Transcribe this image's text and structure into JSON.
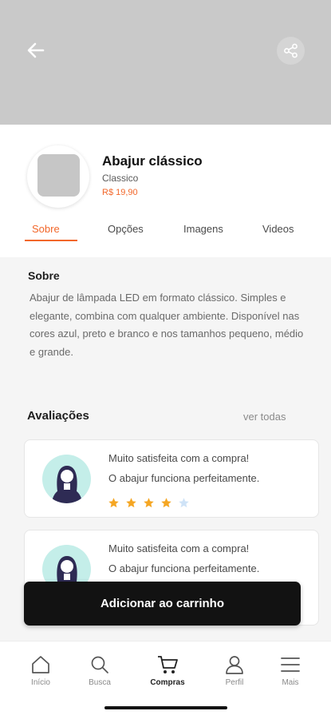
{
  "header": {
    "back_icon": "arrow-left-icon",
    "share_icon": "share-icon"
  },
  "product": {
    "title": "Abajur clássico",
    "subtitle": "Classico",
    "price": "R$ 19,90"
  },
  "tabs": [
    {
      "label": "Sobre",
      "active": true
    },
    {
      "label": "Opções",
      "active": false
    },
    {
      "label": "Imagens",
      "active": false
    },
    {
      "label": "Videos",
      "active": false
    }
  ],
  "about": {
    "title": "Sobre",
    "description": "Abajur de lâmpada LED em formato clássico. Simples e elegante, combina com qualquer ambiente. Disponível nas cores azul, preto e branco e nos tamanhos pequeno, médio e grande."
  },
  "reviews": {
    "title": "Avaliações",
    "see_all": "ver todas",
    "items": [
      {
        "line1": "Muito satisfeita com a compra!",
        "line2": "O abajur funciona perfeitamente.",
        "rating": 4,
        "max_rating": 5
      },
      {
        "line1": "Muito satisfeita com a compra!",
        "line2": "O abajur funciona perfeitamente."
      }
    ]
  },
  "cart_button": "Adicionar ao carrinho",
  "nav": [
    {
      "label": "Início",
      "icon": "home-icon",
      "active": false
    },
    {
      "label": "Busca",
      "icon": "search-icon",
      "active": false
    },
    {
      "label": "Compras",
      "icon": "cart-icon",
      "active": true
    },
    {
      "label": "Perfil",
      "icon": "user-icon",
      "active": false
    },
    {
      "label": "Mais",
      "icon": "menu-icon",
      "active": false
    }
  ],
  "colors": {
    "accent": "#f2672a",
    "star_filled": "#f5a623",
    "star_empty": "#cfe3f7",
    "header_bg": "#c9c9c9",
    "button_bg": "#121212"
  }
}
